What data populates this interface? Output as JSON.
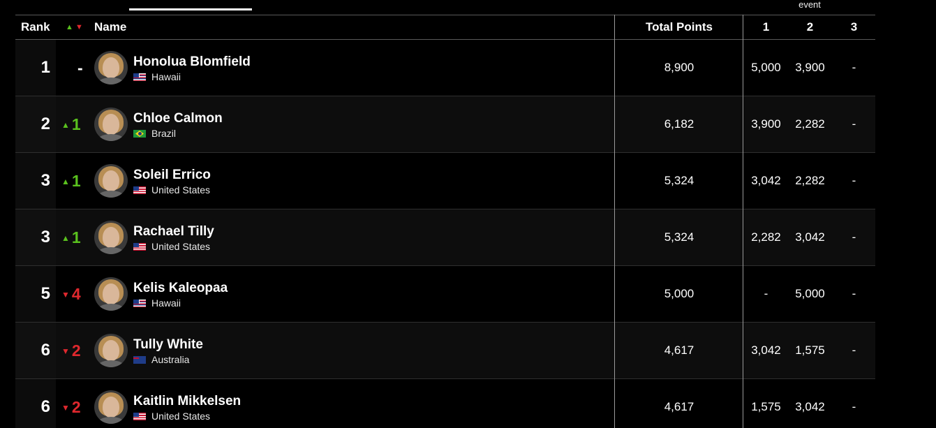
{
  "header": {
    "event_label": "event",
    "rank": "Rank",
    "move_up": "▲",
    "move_down": "▼",
    "name": "Name",
    "total_points": "Total Points",
    "event_1": "1",
    "event_2": "2",
    "event_3": "3"
  },
  "colors": {
    "up": "#5ac11e",
    "down": "#e0282e",
    "background": "#000000"
  },
  "rows": [
    {
      "rank": "1",
      "move_arrow": "",
      "move_value": "-",
      "move_dir": "same",
      "name": "Honolua Blomfield",
      "flag": "hi",
      "country": "Hawaii",
      "total": "8,900",
      "e1": "5,000",
      "e2": "3,900",
      "e3": "-"
    },
    {
      "rank": "2",
      "move_arrow": "▲",
      "move_value": "1",
      "move_dir": "up",
      "name": "Chloe Calmon",
      "flag": "br",
      "country": "Brazil",
      "total": "6,182",
      "e1": "3,900",
      "e2": "2,282",
      "e3": "-"
    },
    {
      "rank": "3",
      "move_arrow": "▲",
      "move_value": "1",
      "move_dir": "up",
      "name": "Soleil Errico",
      "flag": "us",
      "country": "United States",
      "total": "5,324",
      "e1": "3,042",
      "e2": "2,282",
      "e3": "-"
    },
    {
      "rank": "3",
      "move_arrow": "▲",
      "move_value": "1",
      "move_dir": "up",
      "name": "Rachael Tilly",
      "flag": "us",
      "country": "United States",
      "total": "5,324",
      "e1": "2,282",
      "e2": "3,042",
      "e3": "-"
    },
    {
      "rank": "5",
      "move_arrow": "▼",
      "move_value": "4",
      "move_dir": "down",
      "name": "Kelis Kaleopaa",
      "flag": "hi",
      "country": "Hawaii",
      "total": "5,000",
      "e1": "-",
      "e2": "5,000",
      "e3": "-"
    },
    {
      "rank": "6",
      "move_arrow": "▼",
      "move_value": "2",
      "move_dir": "down",
      "name": "Tully White",
      "flag": "au",
      "country": "Australia",
      "total": "4,617",
      "e1": "3,042",
      "e2": "1,575",
      "e3": "-"
    },
    {
      "rank": "6",
      "move_arrow": "▼",
      "move_value": "2",
      "move_dir": "down",
      "name": "Kaitlin Mikkelsen",
      "flag": "us",
      "country": "United States",
      "total": "4,617",
      "e1": "1,575",
      "e2": "3,042",
      "e3": "-"
    }
  ]
}
